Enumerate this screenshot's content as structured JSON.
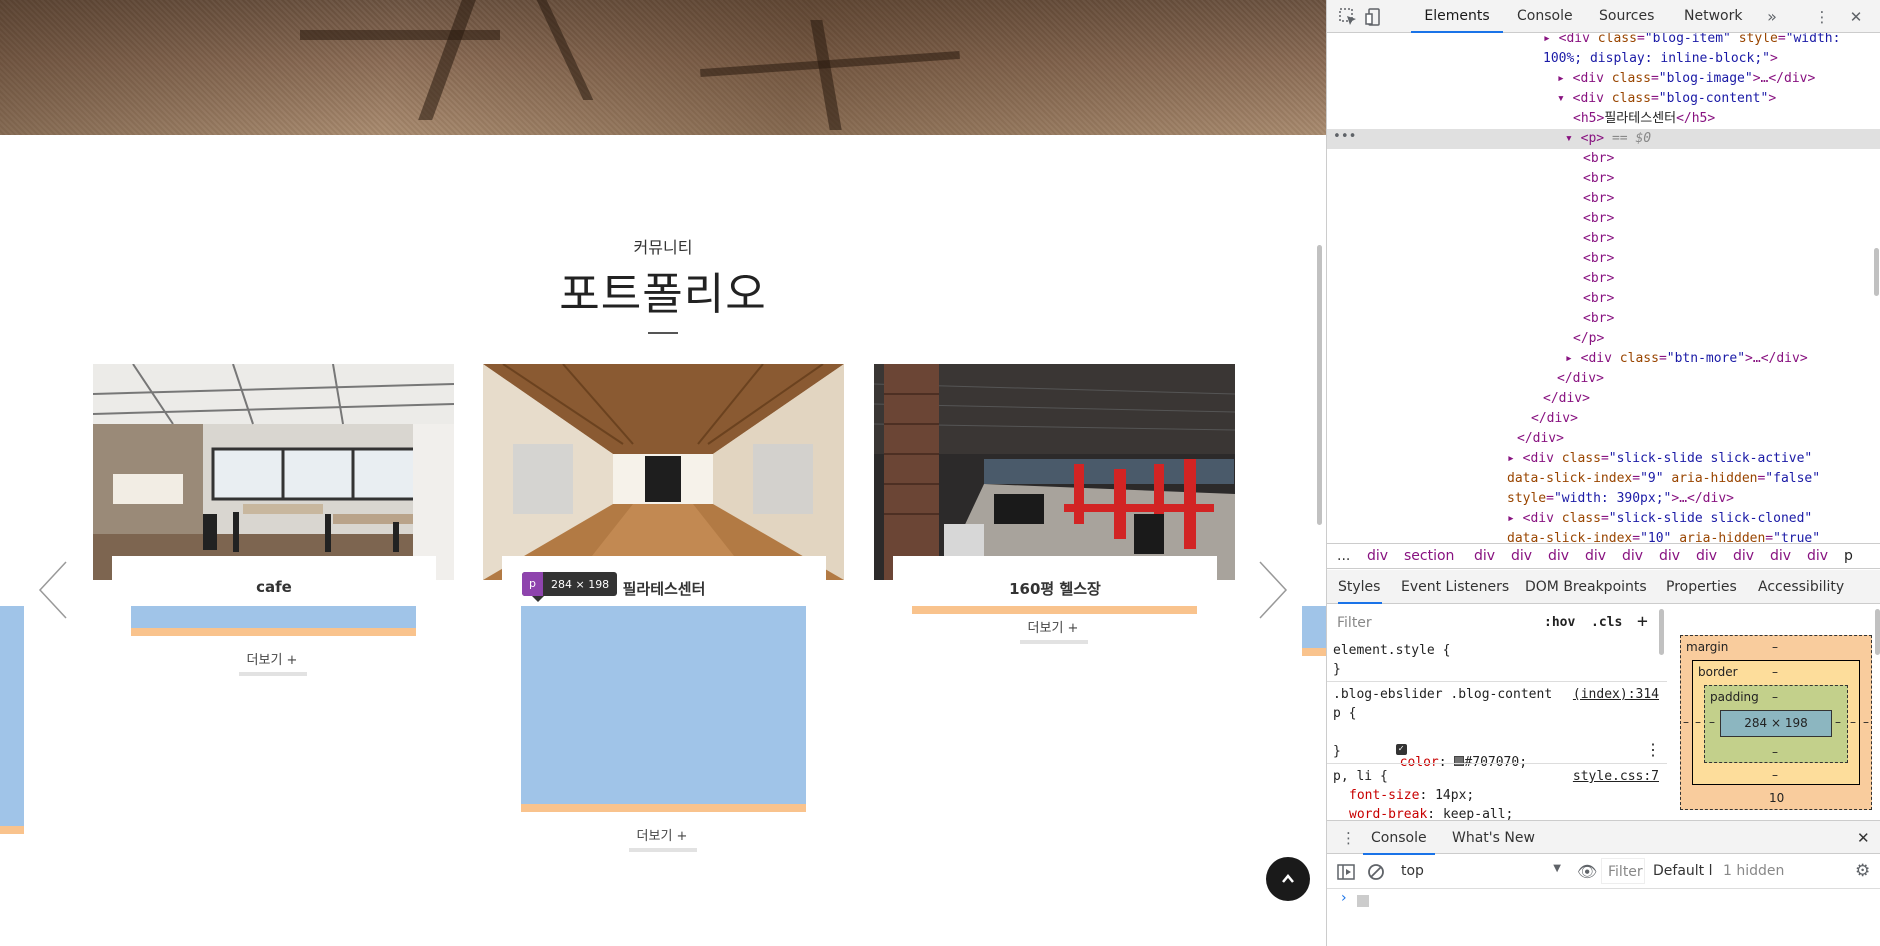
{
  "site": {
    "section_sub": "커뮤니티",
    "section_title": "포트폴리오",
    "cards": [
      {
        "name": "cafe",
        "more": "더보기 +"
      },
      {
        "name": "필라테스센터",
        "more": "더보기 +"
      },
      {
        "name": "160평 헬스장",
        "more": "더보기 +"
      }
    ],
    "tooltip": {
      "tag": "p",
      "size": "284 × 198"
    },
    "top_button_icon": "chevron-up-icon"
  },
  "devtools": {
    "tabs": [
      "Elements",
      "Console",
      "Sources",
      "Network"
    ],
    "more_tabs_icon": "double-chevron-icon",
    "dom_lines": [
      {
        "html": "<span class='t'>▸ &lt;div</span> <span class='an'>class</span>=<span class='av'>\"blog-item\"</span> <span class='an'>style</span>=<span class='av'>\"width:</span>"
      },
      {
        "html": "<span class='av'>100%; display: inline-block;\"</span><span class='t'>&gt;</span>"
      },
      {
        "html": "<span class='t'>▸ &lt;div</span> <span class='an'>class</span>=<span class='av'>\"blog-image\"</span><span class='t'>&gt;…&lt;/div&gt;</span>"
      },
      {
        "html": "<span class='t'>▾ &lt;div</span> <span class='an'>class</span>=<span class='av'>\"blog-content\"</span><span class='t'>&gt;</span>"
      },
      {
        "html": "<span class='t'>&lt;h5&gt;</span><span class='tx'>필라테스센터</span><span class='t'>&lt;/h5&gt;</span>"
      },
      {
        "html": "<span class='t'>▾ &lt;p&gt;</span> <span class='cm'>== $0</span>"
      },
      {
        "html": "<span class='t'>&lt;br&gt;</span>"
      },
      {
        "html": "<span class='t'>&lt;br&gt;</span>"
      },
      {
        "html": "<span class='t'>&lt;br&gt;</span>"
      },
      {
        "html": "<span class='t'>&lt;br&gt;</span>"
      },
      {
        "html": "<span class='t'>&lt;br&gt;</span>"
      },
      {
        "html": "<span class='t'>&lt;br&gt;</span>"
      },
      {
        "html": "<span class='t'>&lt;br&gt;</span>"
      },
      {
        "html": "<span class='t'>&lt;br&gt;</span>"
      },
      {
        "html": "<span class='t'>&lt;br&gt;</span>"
      },
      {
        "html": "<span class='t'>&lt;/p&gt;</span>"
      },
      {
        "html": "<span class='t'>▸ &lt;div</span> <span class='an'>class</span>=<span class='av'>\"btn-more\"</span><span class='t'>&gt;…&lt;/div&gt;</span>"
      },
      {
        "html": "<span class='t'>&lt;/div&gt;</span>"
      },
      {
        "html": "<span class='t'>&lt;/div&gt;</span>"
      },
      {
        "html": "<span class='t'>&lt;/div&gt;</span>"
      },
      {
        "html": "<span class='t'>&lt;/div&gt;</span>"
      },
      {
        "html": "<span class='t'>▸ &lt;div</span> <span class='an'>class</span>=<span class='av'>\"slick-slide slick-active\"</span>"
      },
      {
        "html": "<span class='an'>data-slick-index</span>=<span class='av'>\"9\"</span> <span class='an'>aria-hidden</span>=<span class='av'>\"false\"</span>"
      },
      {
        "html": "<span class='an'>style</span>=<span class='av'>\"width: 390px;\"</span><span class='t'>&gt;…&lt;/div&gt;</span>"
      },
      {
        "html": "<span class='t'>▸ &lt;div</span> <span class='an'>class</span>=<span class='av'>\"slick-slide slick-cloned\"</span>"
      },
      {
        "html": "<span class='an'>data-slick-index</span>=<span class='av'>\"10\"</span> <span class='an'>aria-hidden</span>=<span class='av'>\"true\"</span>"
      }
    ],
    "crumbs": [
      "...",
      "div",
      "section",
      "div",
      "div",
      "div",
      "div",
      "div",
      "div",
      "div",
      "div",
      "div",
      "div",
      "p"
    ],
    "sub_tabs": [
      "Styles",
      "Event Listeners",
      "DOM Breakpoints",
      "Properties",
      "Accessibility"
    ],
    "styles": {
      "filter_placeholder": "Filter",
      "hov": ":hov",
      "cls": ".cls",
      "element_style": "element.style {",
      "close_brace": "}",
      "rule1_selector": ".blog-ebslider .blog-content",
      "rule1_selector2": "p {",
      "rule1_link": "(index):314",
      "rule1_prop": "color",
      "rule1_value": "#707070;",
      "rule2_selector": "p, li {",
      "rule2_link": "style.css:7",
      "rule2_prop1": "font-size",
      "rule2_value1": "14px;",
      "rule2_prop2": "word-break",
      "rule2_value2": "keep-all;"
    },
    "box_model": {
      "margin_label": "margin",
      "border_label": "border",
      "padding_label": "padding",
      "content_size": "284 × 198",
      "dash": "–",
      "bottom_margin": "10"
    },
    "console": {
      "tabs": [
        "Console",
        "What's New"
      ],
      "context": "top",
      "filter_placeholder": "Filter",
      "levels": "Default l",
      "hidden": "1 hidden"
    }
  }
}
